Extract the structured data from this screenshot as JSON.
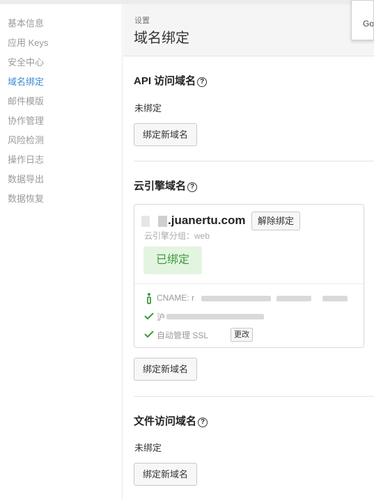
{
  "sidebar": {
    "items": [
      {
        "label": "基本信息"
      },
      {
        "label": "应用 Keys"
      },
      {
        "label": "安全中心"
      },
      {
        "label": "域名绑定",
        "active": true
      },
      {
        "label": "邮件模版"
      },
      {
        "label": "协作管理"
      },
      {
        "label": "风险检测"
      },
      {
        "label": "操作日志"
      },
      {
        "label": "数据导出"
      },
      {
        "label": "数据恢复"
      }
    ]
  },
  "header": {
    "breadcrumb": "设置",
    "title": "域名绑定"
  },
  "popup": {
    "text": "Go"
  },
  "api_domain": {
    "title": "API 访问域名",
    "help_icon": "question-circle-icon",
    "status": "未绑定",
    "bind_button": "绑定新域名"
  },
  "engine_domain": {
    "title": "云引擎域名",
    "help_icon": "question-circle-icon",
    "card": {
      "domain": ".juanertu.com",
      "unbind_button": "解除绑定",
      "group": "云引擎分组：web",
      "badge": "已绑定",
      "cname_label": "CNAME: r",
      "row2_label": "沪",
      "ssl_label": "自动管理 SSL",
      "change_button": "更改"
    },
    "bind_button": "绑定新域名"
  },
  "file_domain": {
    "title": "文件访问域名",
    "help_icon": "question-circle-icon",
    "status": "未绑定",
    "bind_button": "绑定新域名"
  },
  "colors": {
    "active_link": "#3c8ad6",
    "success": "#3a9b3a",
    "badge_bg": "#e3f5e1"
  }
}
